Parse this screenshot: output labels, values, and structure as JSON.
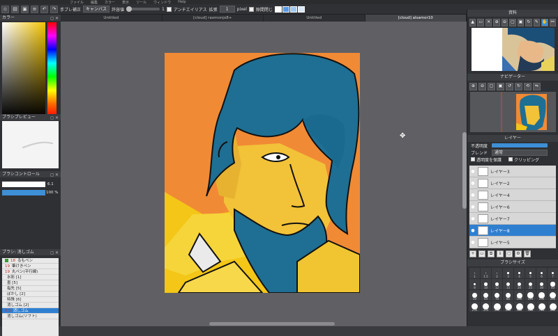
{
  "menubar": {
    "items": [
      "ファイル",
      "編集",
      "カラー",
      "表示",
      "ツール",
      "ウィンドウ",
      "Help"
    ]
  },
  "toolbar": {
    "hand_label": "手ブレ補正",
    "canvas_select": "キャンバス",
    "tolerance_label": "許容値",
    "tolerance_value": "1",
    "antialias_label": "アンチエイリアス",
    "expand_label": "拡張",
    "expand_value": "1",
    "expand_unit": "pixel",
    "close_gap_label": "隙間閉じ",
    "swatch_colors": [
      "#ffffff",
      "#5a9be0",
      "#9fc8f0",
      "#d8e8f8"
    ]
  },
  "tabs": [
    {
      "label": "Untitled",
      "active": false
    },
    {
      "label": "[cloud] raomonjo8+",
      "active": false
    },
    {
      "label": "Untitled",
      "active": false
    },
    {
      "label": "[cloud] alsamor10",
      "active": true
    }
  ],
  "left": {
    "color_title": "カラー",
    "brush_preview_title": "ブラシプレビュー",
    "brush_control_title": "ブラシコントロール",
    "brush_size_value": "6.1",
    "brush_opacity_value": "100 %",
    "brush_list_title": "ブラシ: 消しゴム",
    "brushes": [
      {
        "num": "18",
        "name": "るもペン",
        "selected": false,
        "chip": true
      },
      {
        "num": "19",
        "name": "筆けきペン",
        "selected": false,
        "chip": false
      },
      {
        "num": "19",
        "name": "丸ペン(平行線)",
        "selected": false,
        "chip": false
      },
      {
        "num": "",
        "name": "水彩 [1]",
        "selected": false,
        "chip": false
      },
      {
        "num": "",
        "name": "墨 [5]",
        "selected": false,
        "chip": false
      },
      {
        "num": "",
        "name": "指先 [5]",
        "selected": false,
        "chip": false
      },
      {
        "num": "",
        "name": "ぼかし [2]",
        "selected": false,
        "chip": false
      },
      {
        "num": "",
        "name": "特殊 [6]",
        "selected": false,
        "chip": false
      },
      {
        "num": "",
        "name": "消しゴム [2]",
        "selected": false,
        "chip": false
      },
      {
        "num": "5.1",
        "name": "消しゴム",
        "selected": true,
        "chip": false
      },
      {
        "num": "",
        "name": "消しゴム(ソフト)",
        "selected": false,
        "chip": false
      }
    ]
  },
  "right": {
    "reference_title": "資料",
    "navigator_title": "ナビゲーター",
    "layer_title": "レイヤー",
    "opacity_label": "不透明度",
    "blend_label": "ブレンド",
    "blend_value": "通常",
    "protect_label": "透明度を保護",
    "clipping_label": "クリッピング",
    "layers": [
      {
        "name": "レイヤー3",
        "selected": false,
        "gray": false
      },
      {
        "name": "レイヤー2",
        "selected": false,
        "gray": false
      },
      {
        "name": "レイヤー4",
        "selected": false,
        "gray": false
      },
      {
        "name": "レイヤー6",
        "selected": false,
        "gray": false
      },
      {
        "name": "レイヤー7",
        "selected": false,
        "gray": false
      },
      {
        "name": "レイヤー8",
        "selected": true,
        "gray": false
      },
      {
        "name": "レイヤー5",
        "selected": false,
        "gray": false
      }
    ],
    "brush_size_title": "ブラシサイズ",
    "sizes": [
      "1",
      "1.5",
      "2",
      "3",
      "4",
      "5",
      "6",
      "7",
      "8",
      "10",
      "12",
      "15",
      "20",
      "25",
      "30",
      "40",
      "50",
      "60",
      "70",
      "80",
      "100",
      "120",
      "150",
      "200",
      "250",
      "300",
      "350",
      "400",
      "500",
      "600",
      "700",
      "800"
    ]
  }
}
